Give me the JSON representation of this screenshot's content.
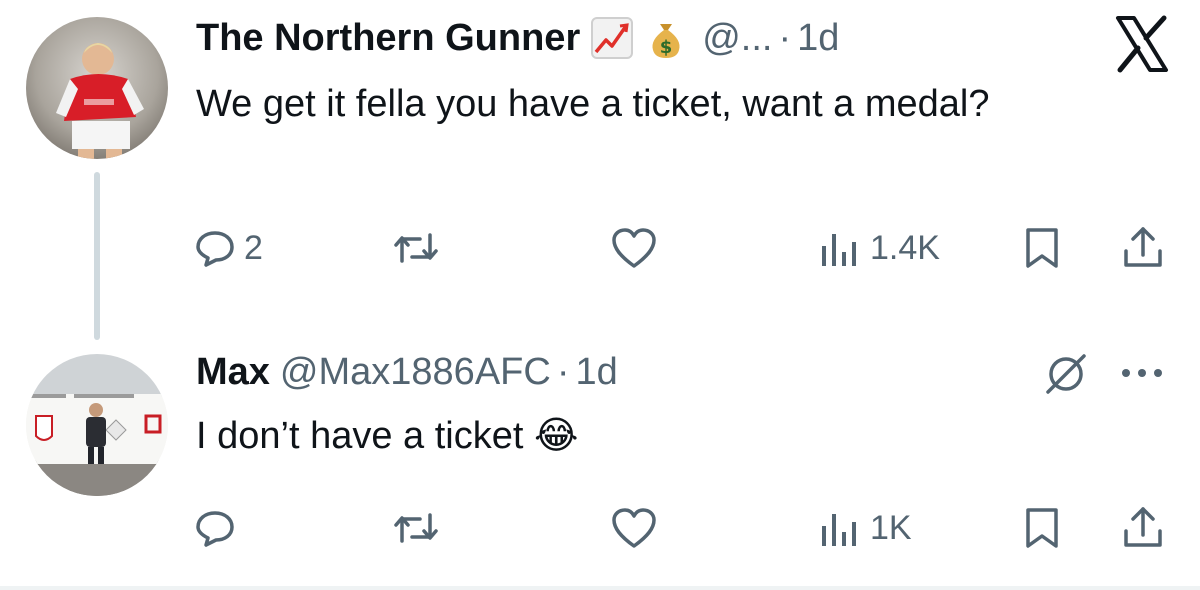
{
  "colors": {
    "text_primary": "#0f1419",
    "text_secondary": "#536471",
    "icon": "#536471",
    "thread_line": "#cfd9de"
  },
  "tweet1": {
    "author_name": "The Northern Gunner",
    "badges": [
      "chart-increasing-emoji",
      "money-bag-emoji"
    ],
    "handle": "@...",
    "separator": "·",
    "time": "1d",
    "text": "We get it fella you have a ticket, want a medal?",
    "actions": {
      "replies": "2",
      "retweets": "",
      "likes": "",
      "views": "1.4K"
    }
  },
  "tweet2": {
    "author_name": "Max",
    "handle": "@Max1886AFC",
    "separator": "·",
    "time": "1d",
    "text": "I don’t have a ticket 😂",
    "actions": {
      "replies": "",
      "retweets": "",
      "likes": "",
      "views": "1K"
    }
  }
}
